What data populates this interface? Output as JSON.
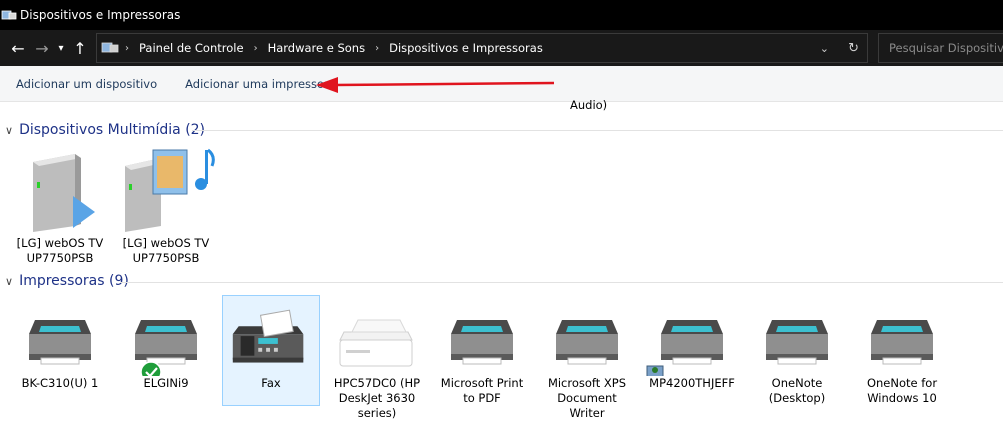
{
  "window": {
    "title": "Dispositivos e Impressoras"
  },
  "address": {
    "crumbs": [
      "Painel de Controle",
      "Hardware e Sons",
      "Dispositivos e Impressoras"
    ],
    "search_placeholder": "Pesquisar Dispositivos e Impressoras"
  },
  "commands": {
    "add_device": "Adicionar um dispositivo",
    "add_printer": "Adicionar uma impressora"
  },
  "partial_label": "Audio)",
  "groups": {
    "multimedia": {
      "title": "Dispositivos Multimídia (2)",
      "items": [
        {
          "label_line1": "[LG] webOS TV",
          "label_line2": "UP7750PSB"
        },
        {
          "label_line1": "[LG] webOS TV",
          "label_line2": "UP7750PSB"
        }
      ]
    },
    "printers": {
      "title": "Impressoras (9)",
      "items": [
        {
          "line1": "BK-C310(U) 1",
          "line2": "",
          "line3": ""
        },
        {
          "line1": "ELGINi9",
          "line2": "",
          "line3": ""
        },
        {
          "line1": "Fax",
          "line2": "",
          "line3": ""
        },
        {
          "line1": "HPC57DC0 (HP",
          "line2": "DeskJet 3630",
          "line3": "series)"
        },
        {
          "line1": "Microsoft Print",
          "line2": "to PDF",
          "line3": ""
        },
        {
          "line1": "Microsoft XPS",
          "line2": "Document Writer",
          "line3": ""
        },
        {
          "line1": "MP4200THJEFF",
          "line2": "",
          "line3": ""
        },
        {
          "line1": "OneNote",
          "line2": "(Desktop)",
          "line3": ""
        },
        {
          "line1": "OneNote for",
          "line2": "Windows 10",
          "line3": ""
        }
      ]
    }
  },
  "colors": {
    "accent_header": "#1e3287",
    "selection_border": "#99d1ff",
    "arrow": "#e0141e",
    "default_check": "#1f9d3a"
  }
}
